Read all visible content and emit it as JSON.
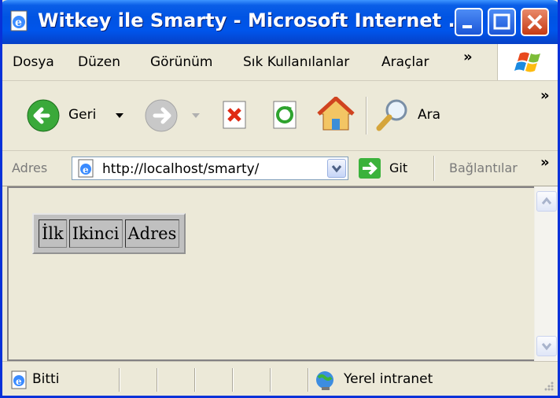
{
  "window": {
    "title": "Witkey ile Smarty - Microsoft Internet ...",
    "accent_color": "#0054e3"
  },
  "menubar": {
    "items": [
      "Dosya",
      "Düzen",
      "Görünüm",
      "Sık Kullanılanlar",
      "Araçlar"
    ],
    "overflow": "»"
  },
  "toolbar": {
    "back_label": "Geri",
    "search_label": "Ara",
    "overflow": "»"
  },
  "address": {
    "label": "Adres",
    "url": "http://localhost/smarty/",
    "go_label": "Git",
    "links_label": "Bağlantılar",
    "overflow": "»"
  },
  "content": {
    "table": {
      "cells": [
        "İlk",
        "Ikinci",
        "Adres"
      ]
    }
  },
  "status": {
    "text": "Bitti",
    "zone": "Yerel intranet"
  }
}
